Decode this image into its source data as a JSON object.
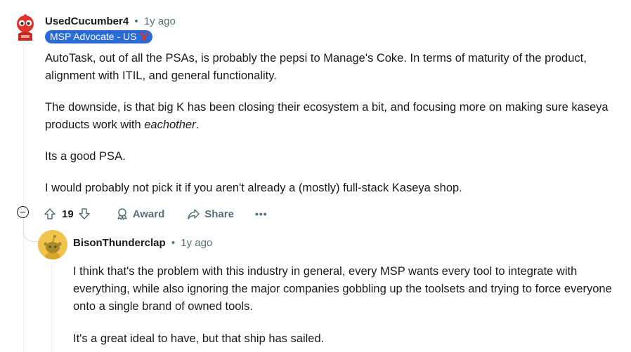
{
  "comment": {
    "username": "UsedCucumber4",
    "separator": "•",
    "time": "1y ago",
    "flair": "MSP Advocate - US",
    "paragraphs": {
      "p1": "AutoTask, out of all the PSAs, is probably the pepsi to Manage's Coke. In terms of maturity of the product, alignment with ITIL, and general functionality.",
      "p2_start": "The downside, is that big K has been closing their ecosystem a bit, and focusing more on making sure kaseya products work with ",
      "p2_em": "eachother",
      "p2_end": ".",
      "p3": "Its a good PSA.",
      "p4": "I would probably not pick it if you aren't already a (mostly) full-stack Kaseya shop."
    },
    "actions": {
      "votes": "19",
      "award": "Award",
      "share": "Share",
      "more": "•••"
    }
  },
  "reply": {
    "username": "BisonThunderclap",
    "separator": "•",
    "time": "1y ago",
    "paragraphs": {
      "p1": "I think that's the problem with this industry in general, every MSP wants every tool to integrate with everything, while also ignoring the major companies gobbling up the toolsets and trying to force everyone onto a single brand of owned tools.",
      "p2": "It's a great ideal to have, but that ship has sailed."
    }
  },
  "colors": {
    "flair_bg": "#2a6bd8",
    "meta_text": "#576f76",
    "thread_line": "#edeff1"
  },
  "icons": [
    "robot-avatar-icon",
    "lobster-emoji-icon",
    "collapse-icon",
    "upvote-icon",
    "downvote-icon",
    "award-icon",
    "share-icon",
    "more-icon",
    "snoo-avatar-icon"
  ]
}
